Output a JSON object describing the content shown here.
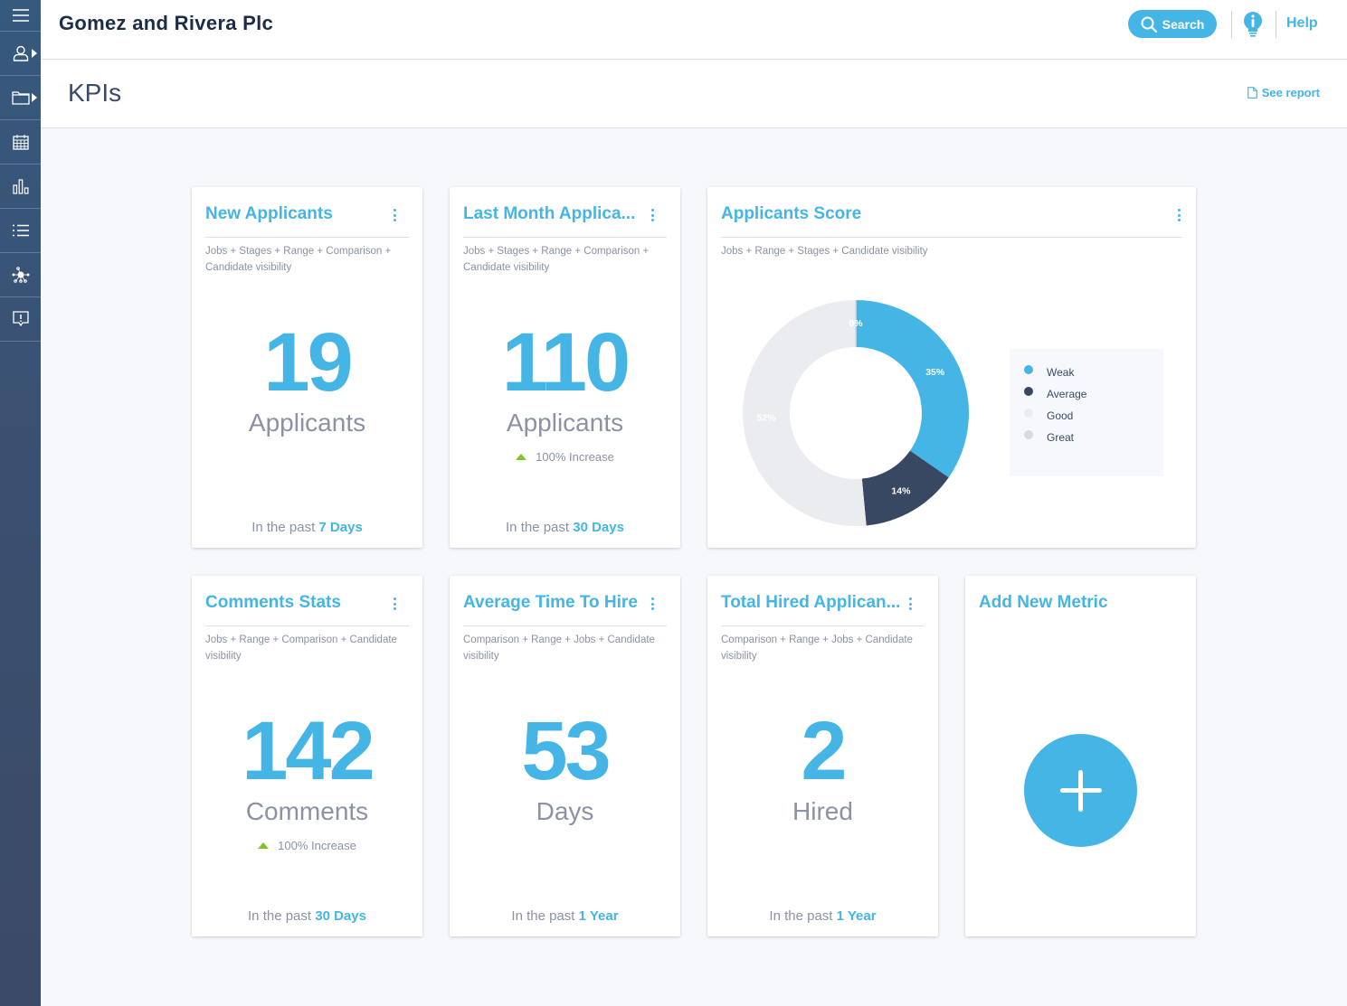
{
  "sidebar": {
    "items": [
      {
        "icon": "menu-icon"
      },
      {
        "icon": "user-icon",
        "has_submenu": true
      },
      {
        "icon": "folder-icon",
        "has_submenu": true
      },
      {
        "icon": "calendar-icon"
      },
      {
        "icon": "bar-chart-icon"
      },
      {
        "icon": "list-icon"
      },
      {
        "icon": "network-icon"
      },
      {
        "icon": "feedback-icon"
      }
    ]
  },
  "header": {
    "company": "Gomez and Rivera Plc",
    "search_label": "Search",
    "help_label": "Help"
  },
  "page": {
    "title": "KPIs",
    "see_report": "See report"
  },
  "colors": {
    "accent": "#45b5e6",
    "sidebar": "#3b4a66",
    "increase": "#7cc52a"
  },
  "cards": [
    {
      "title": "New Applicants",
      "filters": "Jobs + Stages + Range + Comparison + Candidate visibility",
      "value": "19",
      "unit": "Applicants",
      "trend": null,
      "period_prefix": "In the past",
      "period_value": "7 Days"
    },
    {
      "title": "Last Month Applica...",
      "filters": "Jobs + Stages + Range + Comparison + Candidate visibility",
      "value": "110",
      "unit": "Applicants",
      "trend": "100% Increase",
      "period_prefix": "In the past",
      "period_value": "30 Days"
    },
    {
      "title": "Applicants Score",
      "filters": "Jobs + Range + Stages + Candidate visibility"
    },
    {
      "title": "Comments Stats",
      "filters": "Jobs + Range + Comparison + Candidate visibility",
      "value": "142",
      "unit": "Comments",
      "trend": "100% Increase",
      "period_prefix": "In the past",
      "period_value": "30 Days"
    },
    {
      "title": "Average Time To Hire",
      "filters": "Comparison + Range + Jobs + Candidate visibility",
      "value": "53",
      "unit": "Days",
      "trend": null,
      "period_prefix": "In the past",
      "period_value": "1 Year"
    },
    {
      "title": "Total Hired Applican...",
      "filters": "Comparison + Range + Jobs + Candidate visibility",
      "value": "2",
      "unit": "Hired",
      "trend": null,
      "period_prefix": "In the past",
      "period_value": "1 Year"
    },
    {
      "title": "Add New Metric"
    }
  ],
  "chart_data": {
    "type": "pie",
    "title": "Applicants Score",
    "donut": true,
    "categories": [
      "Weak",
      "Average",
      "Good",
      "Great"
    ],
    "values": [
      35,
      14,
      52,
      0
    ],
    "labels": [
      "35%",
      "14%",
      "52%",
      "0%"
    ],
    "colors": [
      "#45b5e6",
      "#394862",
      "#ebecef",
      "#d6d9de"
    ],
    "legend_position": "right"
  }
}
